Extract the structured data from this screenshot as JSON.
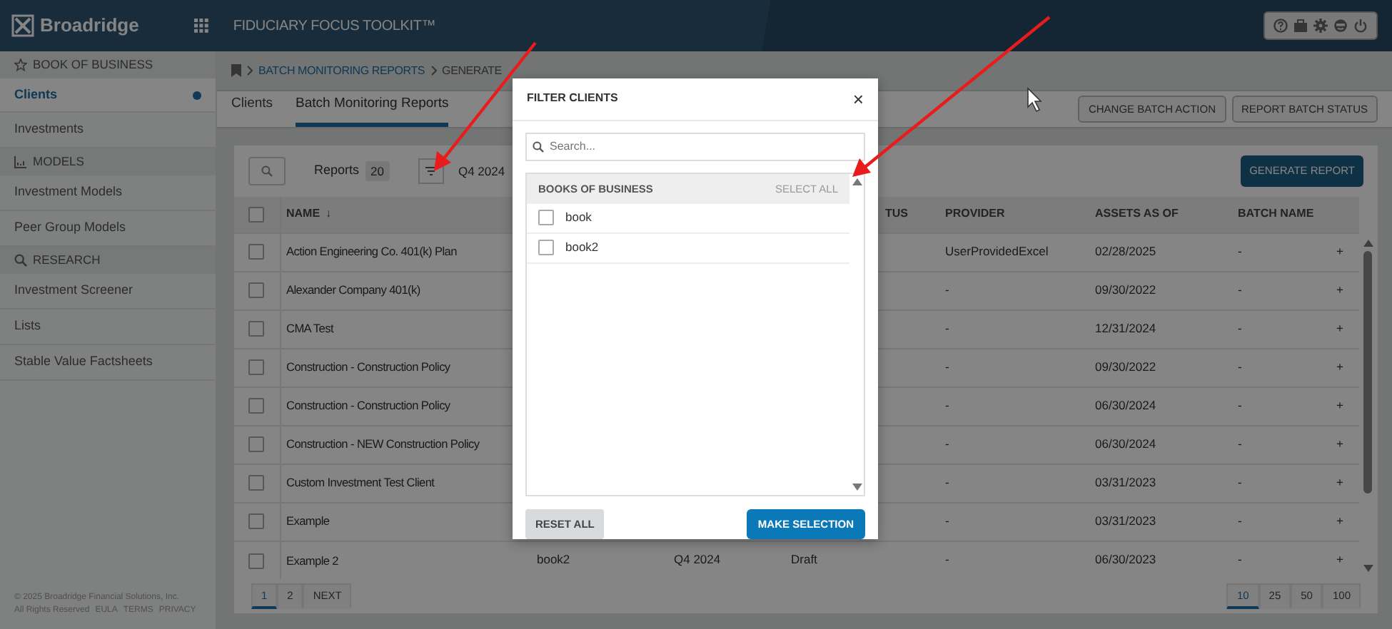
{
  "header": {
    "brand": "Broadridge",
    "app_title": "FIDUCIARY FOCUS TOOLKIT™"
  },
  "sidebar": {
    "sections": [
      {
        "title": "BOOK OF BUSINESS",
        "items": [
          {
            "label": "Clients",
            "selected": true
          },
          {
            "label": "Investments",
            "selected": false
          }
        ]
      },
      {
        "title": "MODELS",
        "items": [
          {
            "label": "Investment Models",
            "selected": false
          },
          {
            "label": "Peer Group Models",
            "selected": false
          }
        ]
      },
      {
        "title": "RESEARCH",
        "items": [
          {
            "label": "Investment Screener",
            "selected": false
          },
          {
            "label": "Lists",
            "selected": false
          },
          {
            "label": "Stable Value Factsheets",
            "selected": false
          }
        ]
      }
    ],
    "footer": {
      "copyright": "© 2025 Broadridge Financial Solutions, Inc.",
      "rights": "All Rights Reserved",
      "links": [
        "EULA",
        "TERMS",
        "PRIVACY"
      ]
    }
  },
  "breadcrumb": [
    {
      "label": "BATCH MONITORING REPORTS",
      "kind": "link"
    },
    {
      "label": "GENERATE",
      "kind": "current"
    }
  ],
  "tabs": [
    {
      "label": "Clients",
      "selected": false
    },
    {
      "label": "Batch Monitoring Reports",
      "selected": true
    }
  ],
  "actions": [
    "CHANGE BATCH ACTION",
    "REPORT BATCH STATUS"
  ],
  "toolbar": {
    "reports_label": "Reports",
    "reports_count": "20",
    "period": "Q4 2024",
    "generate_button": "GENERATE REPORT"
  },
  "table": {
    "select_all_checked": false,
    "columns": [
      {
        "label": "NAME",
        "sort_mark": "↓"
      },
      null,
      null,
      {
        "label": "TUS"
      },
      {
        "label": "PROVIDER"
      },
      {
        "label": "ASSETS AS OF"
      },
      {
        "label": "BATCH NAME"
      }
    ],
    "rows": [
      {
        "checked": false,
        "cells": [
          "Action Engineering Co. 401(k) Plan",
          null,
          null,
          null,
          "UserProvidedExcel",
          "02/28/2025",
          "-"
        ],
        "action": "+"
      },
      {
        "checked": false,
        "cells": [
          "Alexander Company 401(k)",
          null,
          null,
          null,
          "-",
          "09/30/2022",
          "-"
        ],
        "action": "+"
      },
      {
        "checked": false,
        "cells": [
          "CMA Test",
          null,
          null,
          null,
          "-",
          "12/31/2024",
          "-"
        ],
        "action": "+"
      },
      {
        "checked": false,
        "cells": [
          "Construction - Construction Policy",
          null,
          null,
          null,
          "-",
          "09/30/2022",
          "-"
        ],
        "action": "+"
      },
      {
        "checked": false,
        "cells": [
          "Construction - Construction Policy",
          null,
          null,
          null,
          "-",
          "06/30/2024",
          "-"
        ],
        "action": "+"
      },
      {
        "checked": false,
        "cells": [
          "Construction - NEW Construction Policy",
          null,
          null,
          null,
          "-",
          "06/30/2024",
          "-"
        ],
        "action": "+"
      },
      {
        "checked": false,
        "cells": [
          "Custom Investment Test Client",
          null,
          null,
          null,
          "-",
          "03/31/2023",
          "-"
        ],
        "action": "+"
      },
      {
        "checked": false,
        "cells": [
          "Example",
          null,
          null,
          null,
          "-",
          "03/31/2023",
          "-"
        ],
        "action": "+"
      },
      {
        "checked": false,
        "cells": [
          "Example 2",
          "book2",
          "Q4 2024",
          "Draft",
          "-",
          "06/30/2023",
          "-"
        ],
        "action": "+"
      }
    ]
  },
  "pagination": {
    "pages": [
      {
        "label": "1",
        "selected": true
      },
      {
        "label": "2",
        "selected": false
      }
    ],
    "next": "NEXT",
    "page_sizes": [
      {
        "label": "10",
        "selected": true
      },
      {
        "label": "25",
        "selected": false
      },
      {
        "label": "50",
        "selected": false
      },
      {
        "label": "100",
        "selected": false
      }
    ]
  },
  "modal": {
    "title": "FILTER CLIENTS",
    "close": "×",
    "search_placeholder": "Search...",
    "list_title": "BOOKS OF BUSINESS",
    "select_all": "SELECT ALL",
    "items": [
      {
        "label": "book",
        "checked": false
      },
      {
        "label": "book2",
        "checked": false
      }
    ],
    "reset_button": "RESET ALL",
    "submit_button": "MAKE SELECTION"
  }
}
